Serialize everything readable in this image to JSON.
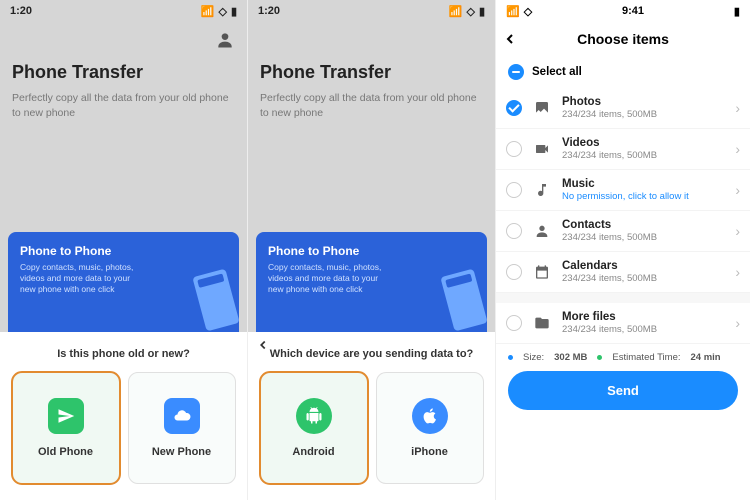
{
  "panel1": {
    "time": "1:20",
    "title": "Phone Transfer",
    "subtitle": "Perfectly copy all the data from your old phone to new phone",
    "card_title": "Phone to Phone",
    "card_desc": "Copy contacts, music, photos, videos and more data to your new phone with one click",
    "question": "Is this phone old or new?",
    "opt1": "Old Phone",
    "opt2": "New Phone"
  },
  "panel2": {
    "time": "1:20",
    "title": "Phone Transfer",
    "subtitle": "Perfectly copy all the data from your old phone to new phone",
    "card_title": "Phone to Phone",
    "card_desc": "Copy contacts, music, photos, videos and more data to your new phone with one click",
    "question": "Which device are you sending data to?",
    "opt1": "Android",
    "opt2": "iPhone"
  },
  "panel3": {
    "time": "9:41",
    "title": "Choose items",
    "selectall": "Select all",
    "items": [
      {
        "name": "Photos",
        "meta": "234/234 items, 500MB",
        "selected": true
      },
      {
        "name": "Videos",
        "meta": "234/234 items, 500MB",
        "selected": false
      },
      {
        "name": "Music",
        "meta": "No permission,  click to allow it",
        "selected": false,
        "link": true
      },
      {
        "name": "Contacts",
        "meta": "234/234 items, 500MB",
        "selected": false
      },
      {
        "name": "Calendars",
        "meta": "234/234 items, 500MB",
        "selected": false
      }
    ],
    "more": {
      "name": "More files",
      "meta": "234/234 items, 500MB"
    },
    "size_label": "Size:",
    "size_value": "302 MB",
    "eta_label": "Estimated Time:",
    "eta_value": "24 min",
    "send": "Send"
  }
}
